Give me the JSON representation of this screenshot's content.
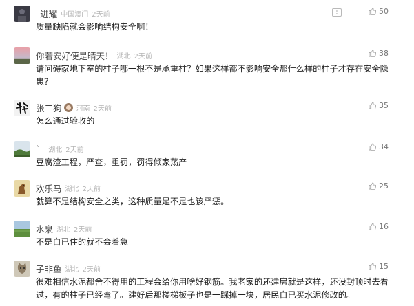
{
  "comments": [
    {
      "username": "_进耀",
      "location": "中国澳门",
      "time": "2天前",
      "text": "质量缺陷就会影响结构安全啊！",
      "likes": "50",
      "has_report": true,
      "avatar_icon": "dark-figure-avatar-icon"
    },
    {
      "username": "你若安好便是晴天！",
      "location": "湖北",
      "time": "2天前",
      "text": "请问碍家地下室的柱子哪一根不是承重柱？如果这样都不影响安全那什么样的柱子才存在安全隐患？",
      "likes": "38",
      "avatar_icon": "sunset-avatar-icon"
    },
    {
      "username": "张二狗",
      "location": "河南",
      "time": "2天前",
      "text": "怎么通过验收的",
      "likes": "35",
      "avatar_icon": "calligraphy-avatar-icon"
    },
    {
      "username": "`",
      "location": "湖北",
      "time": "2天前",
      "text": "豆腐渣工程，严查，重罚，罚得倾家荡产",
      "likes": "34",
      "avatar_icon": "landscape-avatar-icon"
    },
    {
      "username": "欢乐马",
      "location": "湖北",
      "time": "2天前",
      "text": "就算不是结构安全之类，这种质量是不是也该严惩。",
      "likes": "25",
      "avatar_icon": "horse-avatar-icon"
    },
    {
      "username": "水泉",
      "location": "湖北",
      "time": "2天前",
      "text": "不是自已住的就不会着急",
      "likes": "16",
      "avatar_icon": "field-avatar-icon"
    },
    {
      "username": "子非鱼",
      "location": "湖北",
      "time": "2天前",
      "text": "很难相信水泥都舍不得用的工程会给你用啥好钢筋。我老家的还建房就是这样，还没封顶时去看过，有的柱子已经弯了。建好后那楼梯板子也是一踩掉一块，居民自已买水泥修改的。",
      "likes": "15",
      "avatar_icon": "cat-avatar-icon"
    }
  ],
  "colors": {
    "meta": "#b5b5b5",
    "text": "#222222",
    "like": "#999999"
  }
}
